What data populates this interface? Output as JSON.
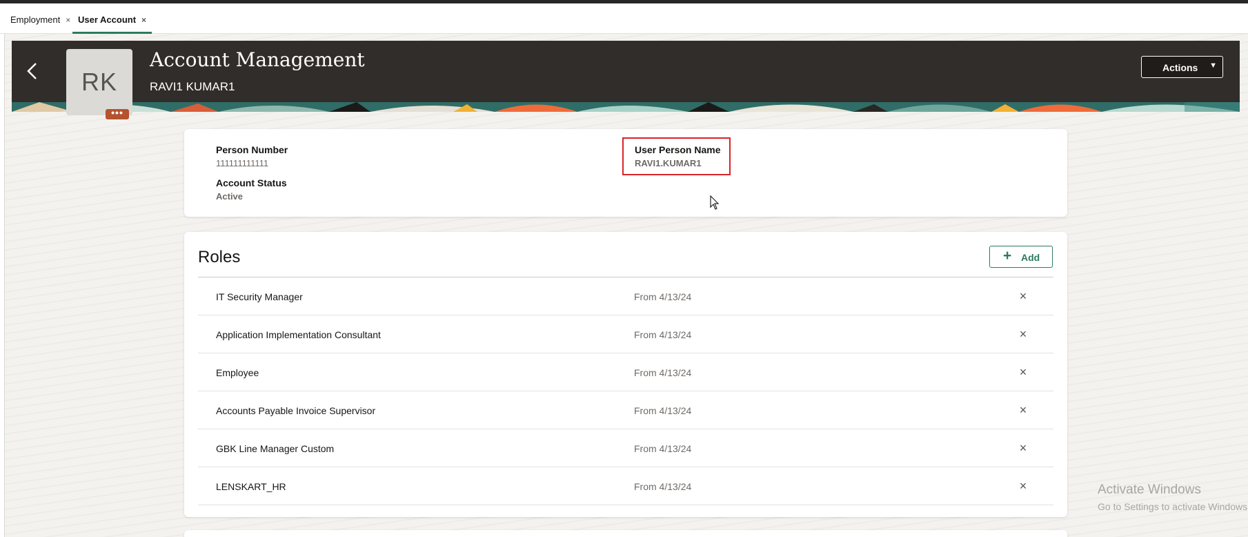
{
  "tabs": [
    {
      "label": "Employment",
      "close": "×"
    },
    {
      "label": "User Account",
      "close": "×"
    }
  ],
  "header": {
    "title": "Account Management",
    "subtitle": "RAVI1 KUMAR1",
    "avatar_initials": "RK",
    "avatar_more": "•••",
    "actions_label": "Actions",
    "actions_caret": "▼"
  },
  "account": {
    "person_number_label": "Person Number",
    "person_number_value": "111111111111",
    "user_person_name_label": "User Person Name",
    "user_person_name_value": "RAVI1.KUMAR1",
    "account_status_label": "Account Status",
    "account_status_value": "Active"
  },
  "roles": {
    "title": "Roles",
    "add_label": "Add",
    "add_icon": "+",
    "remove_icon": "×",
    "items": [
      {
        "name": "IT Security Manager",
        "date": "From 4/13/24"
      },
      {
        "name": "Application Implementation Consultant",
        "date": "From 4/13/24"
      },
      {
        "name": "Employee",
        "date": "From 4/13/24"
      },
      {
        "name": "Accounts Payable Invoice Supervisor",
        "date": "From 4/13/24"
      },
      {
        "name": "GBK Line Manager Custom",
        "date": "From 4/13/24"
      },
      {
        "name": "LENSKART_HR",
        "date": "From 4/13/24"
      }
    ]
  },
  "watermark": {
    "line1": "Activate Windows",
    "line2": "Go to Settings to activate Windows."
  },
  "colors": {
    "header_bg": "#312d2a",
    "accent_green": "#2b7b5e",
    "highlight_red": "#d8232a",
    "avatar_more_bg": "#b5532d"
  },
  "icons": {
    "back": "chevron-left-icon",
    "close": "close-icon",
    "plus": "plus-icon",
    "caret": "caret-down-icon",
    "cursor": "mouse-cursor-icon"
  }
}
